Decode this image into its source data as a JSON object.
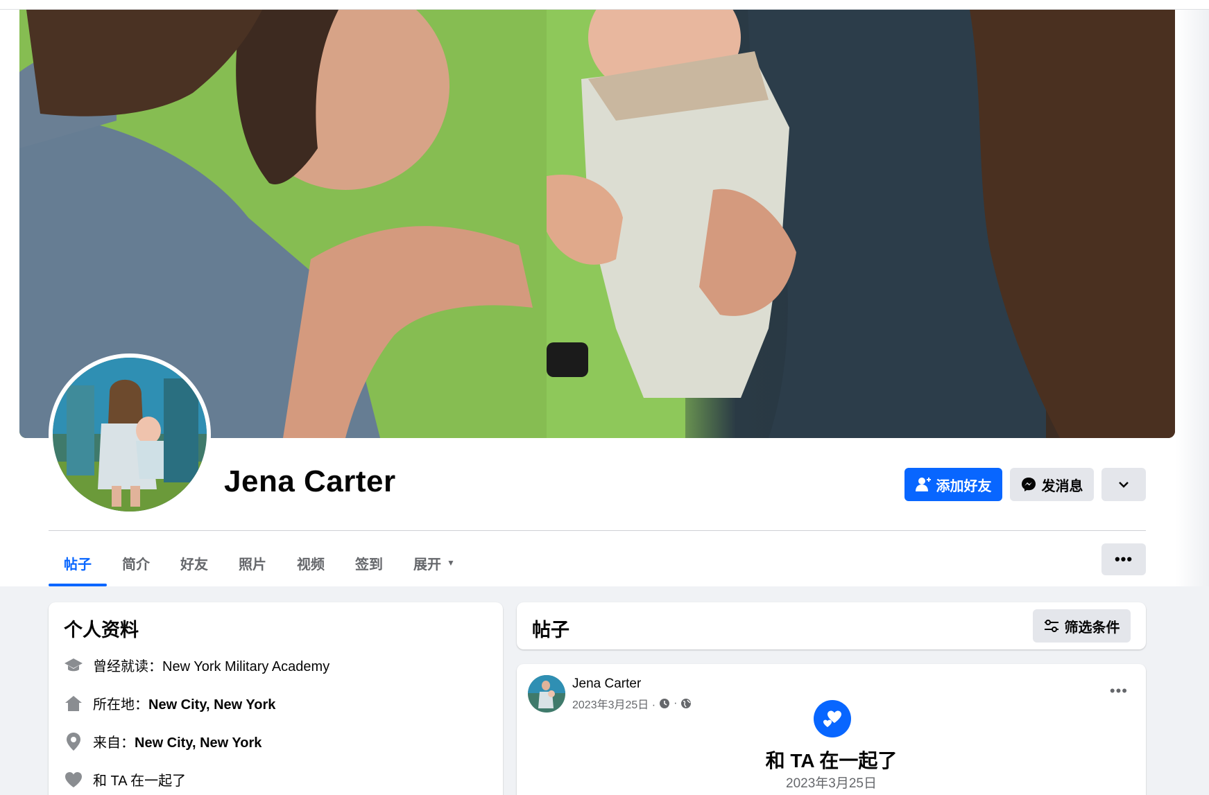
{
  "profile": {
    "name": "Jena Carter"
  },
  "actions": {
    "add_friend": "添加好友",
    "message": "发消息"
  },
  "tabs": [
    {
      "label": "帖子",
      "active": true
    },
    {
      "label": "简介"
    },
    {
      "label": "好友"
    },
    {
      "label": "照片"
    },
    {
      "label": "视频"
    },
    {
      "label": "签到"
    },
    {
      "label": "展开"
    }
  ],
  "intro": {
    "title": "个人资料",
    "rows": [
      {
        "icon": "graduation-cap-icon",
        "prefix": "曾经就读：",
        "value": "New York Military Academy"
      },
      {
        "icon": "home-icon",
        "prefix": "所在地：",
        "value": "New City, New York"
      },
      {
        "icon": "location-pin-icon",
        "prefix": "来自：",
        "value": "New City, New York"
      },
      {
        "icon": "heart-icon",
        "prefix": "",
        "value": "和 TA 在一起了"
      }
    ]
  },
  "posts": {
    "title": "帖子",
    "filter_label": "筛选条件",
    "items": [
      {
        "author": "Jena Carter",
        "date": "2023年3月25日 ·",
        "dot": "·",
        "life_event_title": "和 TA 在一起了",
        "life_event_date": "2023年3月25日"
      }
    ]
  },
  "colors": {
    "accent": "#0866ff",
    "button_grey": "#e4e6eb",
    "text_secondary": "#65676b"
  }
}
